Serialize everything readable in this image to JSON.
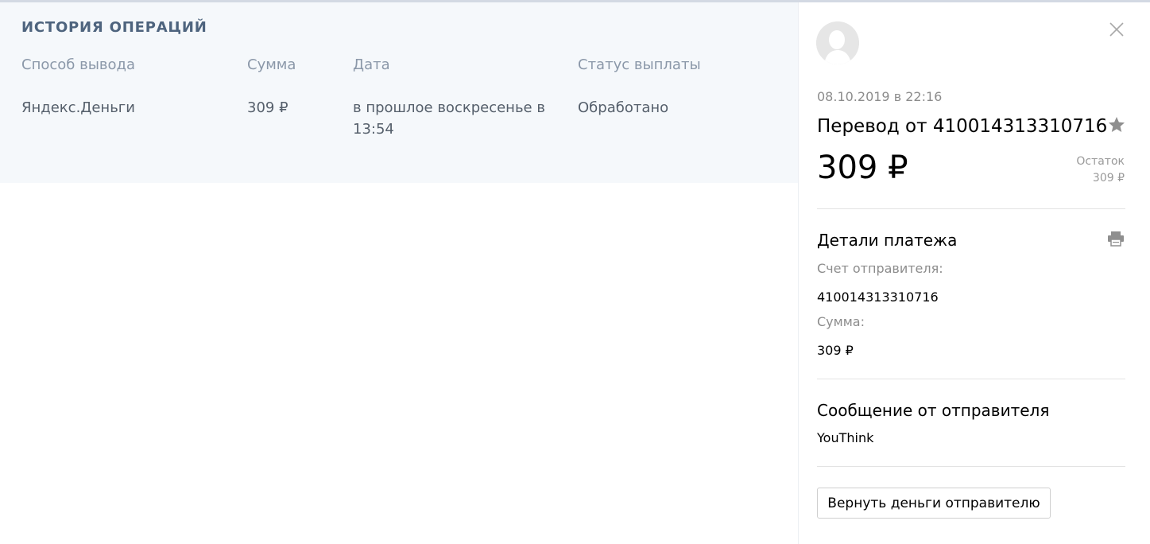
{
  "history": {
    "title": "ИСТОРИЯ ОПЕРАЦИЙ",
    "columns": [
      "Способ вывода",
      "Сумма",
      "Дата",
      "Статус выплаты"
    ],
    "rows": [
      {
        "method": "Яндекс.Деньги",
        "amount": "309 ₽",
        "date": "в прошлое воскресенье в 13:54",
        "status": "Обработано"
      }
    ]
  },
  "details": {
    "datetime": "08.10.2019 в 22:16",
    "title": "Перевод от 410014313310716",
    "amount": "309 ₽",
    "balance_label": "Остаток",
    "balance_value": "309 ₽",
    "payment_details_title": "Детали платежа",
    "sender_account_label": "Счет отправителя:",
    "sender_account_value": "410014313310716",
    "sum_label": "Сумма:",
    "sum_value": "309 ₽",
    "message_title": "Сообщение от отправителя",
    "message_text": "YouThink",
    "refund_button": "Вернуть деньги отправителю",
    "icons": [
      "close-icon",
      "star-icon",
      "printer-icon",
      "avatar"
    ]
  },
  "colors": {
    "history_bg": "#f5f8fb",
    "history_title": "#4e647e",
    "header_text": "#8b98a9",
    "muted_text": "#8c8c8c"
  }
}
